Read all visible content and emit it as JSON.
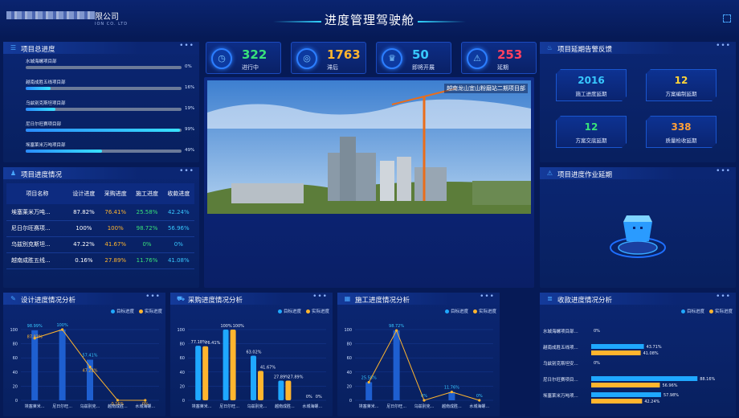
{
  "header": {
    "company_suffix": "限公司",
    "company_sub": "ION CO. LTD",
    "title": "进度管理驾驶舱"
  },
  "colors": {
    "target": "#1fa8ff",
    "actual": "#ffb52e",
    "green": "#38e27a",
    "orange": "#ff9f38"
  },
  "overall": {
    "title": "项目总进度",
    "items": [
      {
        "name": "水城海螺项目部",
        "value": "0%",
        "pct": 0
      },
      {
        "name": "越南成胜五线项目部",
        "value": "16%",
        "pct": 16
      },
      {
        "name": "乌兹别克斯坦项目部",
        "value": "19%",
        "pct": 19
      },
      {
        "name": "尼日尔旺赛项目部",
        "value": "99%",
        "pct": 99
      },
      {
        "name": "埃塞莱米万吨项目部",
        "value": "49%",
        "pct": 49
      }
    ]
  },
  "progress_table": {
    "title": "项目进度情况",
    "headers": [
      "项目名称",
      "设计进度",
      "采购进度",
      "施工进度",
      "收款进度"
    ],
    "rows": [
      [
        "埃塞莱米万吨...",
        "87.82%",
        "76.41%",
        "25.58%",
        "42.24%"
      ],
      [
        "尼日尔旺赛项...",
        "100%",
        "100%",
        "98.72%",
        "56.96%"
      ],
      [
        "乌兹别克斯坦...",
        "47.22%",
        "41.67%",
        "0%",
        "0%"
      ],
      [
        "越南成胜五线...",
        "0.16%",
        "27.89%",
        "11.76%",
        "41.08%"
      ]
    ]
  },
  "stats": [
    {
      "value": "322",
      "label": "进行中",
      "color": "#38e27a",
      "icon": "clock-icon",
      "glyph": "◷"
    },
    {
      "value": "1763",
      "label": "滞后",
      "color": "#ffb52e",
      "icon": "alarm-icon",
      "glyph": "◎"
    },
    {
      "value": "50",
      "label": "即将开展",
      "color": "#38c8ff",
      "icon": "trophy-icon",
      "glyph": "♛"
    },
    {
      "value": "253",
      "label": "延期",
      "color": "#ff4060",
      "icon": "warning-icon",
      "glyph": "⚠"
    }
  ],
  "photo": {
    "caption": "越南龙山宜山粉磨站二期项目部"
  },
  "delay_alert": {
    "title": "项目延期告警反馈",
    "items": [
      {
        "value": "2016",
        "label": "施工进度延期",
        "color": "#38c8ff"
      },
      {
        "value": "12",
        "label": "方案编制延期",
        "color": "#ffd438"
      },
      {
        "value": "12",
        "label": "方案交底延期",
        "color": "#38e27a"
      },
      {
        "value": "338",
        "label": "质量检收延期",
        "color": "#ff9f38"
      }
    ]
  },
  "work_delay": {
    "title": "项目进度作业延期"
  },
  "legend": {
    "target": "目标进度",
    "actual": "实际进度"
  },
  "chart_data": [
    {
      "type": "bar",
      "title": "设计进度情况分析",
      "categories": [
        "埃塞莱米...",
        "尼日尔旺...",
        "乌兹别克...",
        "越南成胜...",
        "水城海螺..."
      ],
      "series": [
        {
          "name": "目标进度",
          "values": [
            98.99,
            100,
            57.41,
            0,
            0
          ]
        },
        {
          "name": "实际进度",
          "values": [
            87.82,
            100,
            47.22,
            0.16,
            0
          ]
        }
      ],
      "labels_target": [
        "98.99%",
        "100%",
        "57.41%",
        "",
        ""
      ],
      "labels_actual": [
        "87.82%",
        "",
        "47.22%",
        "0.16%",
        "0%"
      ],
      "yticks": [
        "100",
        "80",
        "60",
        "40",
        "20",
        "0"
      ],
      "ylim": [
        0,
        100
      ]
    },
    {
      "type": "bar",
      "title": "采购进度情况分析",
      "categories": [
        "埃塞莱米...",
        "尼日尔旺...",
        "乌兹别克...",
        "越南成胜...",
        "水城海螺..."
      ],
      "series": [
        {
          "name": "目标进度",
          "values": [
            77.18,
            100,
            63.02,
            27.89,
            0
          ]
        },
        {
          "name": "实际进度",
          "values": [
            76.41,
            100,
            41.67,
            27.89,
            0
          ]
        }
      ],
      "labels_target": [
        "77.18%",
        "100%",
        "63.02%",
        "27.89%",
        "0%"
      ],
      "labels_actual": [
        "76.41%",
        "100%",
        "41.67%",
        "27.89%",
        "0%"
      ],
      "yticks": [
        "100",
        "80",
        "60",
        "40",
        "20",
        "0"
      ],
      "ylim": [
        0,
        100
      ]
    },
    {
      "type": "bar",
      "title": "施工进度情况分析",
      "categories": [
        "埃塞莱米...",
        "尼日尔旺...",
        "乌兹别克...",
        "越南成胜...",
        "水城海螺..."
      ],
      "series": [
        {
          "name": "目标进度",
          "values": [
            25.58,
            98.72,
            0,
            11.76,
            0
          ]
        },
        {
          "name": "实际进度",
          "values": [
            25.58,
            98.72,
            0,
            11.76,
            0
          ]
        }
      ],
      "labels_target": [
        "25.58%",
        "98.72%",
        "0%",
        "11.76%",
        "0%"
      ],
      "labels_actual": [
        "",
        "",
        "",
        "",
        ""
      ],
      "yticks": [
        "100",
        "80",
        "60",
        "40",
        "20",
        "0"
      ],
      "ylim": [
        0,
        100
      ]
    },
    {
      "type": "bar",
      "title": "收款进度情况分析",
      "categories": [
        "水城海螺项目部...",
        "越南成胜五线项...",
        "乌兹别克斯坦安...",
        "尼日尔旺赛项目...",
        "埃塞莱米万吨项..."
      ],
      "series": [
        {
          "name": "目标进度",
          "values": [
            0,
            43.71,
            0,
            88.16,
            57.98
          ]
        },
        {
          "name": "实际进度",
          "values": [
            0,
            41.08,
            0,
            56.96,
            42.24
          ]
        }
      ],
      "labels_target": [
        "0%",
        "43.71%",
        "0%",
        "88.16%",
        "57.98%"
      ],
      "labels_actual": [
        "",
        "41.08%",
        "",
        "56.96%",
        "42.24%"
      ]
    }
  ]
}
